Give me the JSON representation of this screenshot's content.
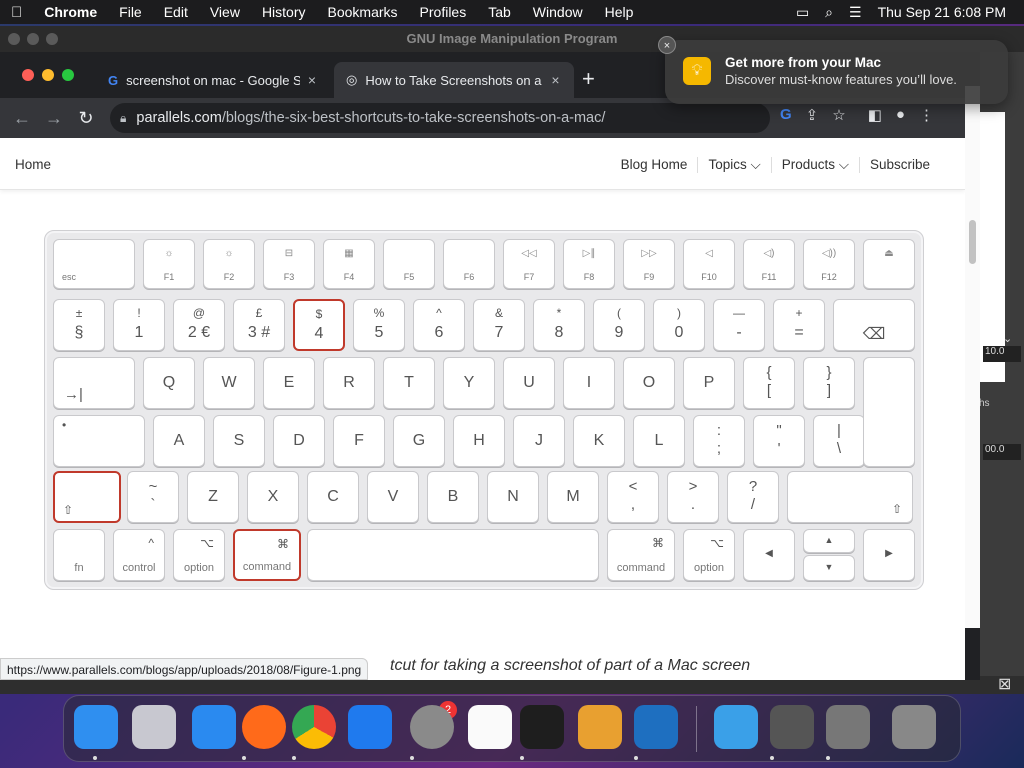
{
  "menubar": {
    "apple_icon": "apple-icon",
    "app": "Chrome",
    "items": [
      "File",
      "Edit",
      "View",
      "History",
      "Bookmarks",
      "Profiles",
      "Tab",
      "Window",
      "Help"
    ],
    "clock": "Thu Sep 21  6:08 PM"
  },
  "gimp": {
    "title": "GNU Image Manipulation Program",
    "zoom1": "10.0",
    "zoom2": "00.0",
    "paths": "hs"
  },
  "browser": {
    "tabs": [
      {
        "title": "screenshot on mac - Google Se",
        "close": "×"
      },
      {
        "title": "How to Take Screenshots on a",
        "close": "×"
      }
    ],
    "new_tab": "+",
    "url_host": "parallels.com",
    "url_path": "/blogs/the-six-best-shortcuts-to-take-screenshots-on-a-mac/"
  },
  "site": {
    "home": "Home",
    "nav": [
      "Blog Home",
      "Topics ⌵",
      "Products ⌵",
      "Subscribe"
    ]
  },
  "keyboard": {
    "fn_row": [
      {
        "s": "esc",
        "g": ""
      },
      {
        "s": "F1",
        "g": "☼"
      },
      {
        "s": "F2",
        "g": "☼"
      },
      {
        "s": "F3",
        "g": "⊟"
      },
      {
        "s": "F4",
        "g": "▦"
      },
      {
        "s": "F5",
        "g": ""
      },
      {
        "s": "F6",
        "g": ""
      },
      {
        "s": "F7",
        "g": "◁◁"
      },
      {
        "s": "F8",
        "g": "▷∥"
      },
      {
        "s": "F9",
        "g": "▷▷"
      },
      {
        "s": "F10",
        "g": "◁"
      },
      {
        "s": "F11",
        "g": "◁)"
      },
      {
        "s": "F12",
        "g": "◁))"
      },
      {
        "s": "",
        "g": "⏏"
      }
    ],
    "num_row": [
      {
        "t": "±",
        "b": "§"
      },
      {
        "t": "!",
        "b": "1"
      },
      {
        "t": "@",
        "b": "2 €"
      },
      {
        "t": "£",
        "b": "3 #"
      },
      {
        "t": "$",
        "b": "4"
      },
      {
        "t": "%",
        "b": "5"
      },
      {
        "t": "^",
        "b": "6"
      },
      {
        "t": "&",
        "b": "7"
      },
      {
        "t": "*",
        "b": "8"
      },
      {
        "t": "(",
        "b": "9"
      },
      {
        "t": ")",
        "b": "0"
      },
      {
        "t": "—",
        "b": "-"
      },
      {
        "t": "+",
        "b": "="
      },
      {
        "t": "",
        "b": "⌫"
      }
    ],
    "q_row": [
      "→|",
      "Q",
      "W",
      "E",
      "R",
      "T",
      "Y",
      "U",
      "I",
      "O",
      "P",
      "{ [",
      "} ]",
      "↵"
    ],
    "a_row": [
      "•",
      "A",
      "S",
      "D",
      "F",
      "G",
      "H",
      "J",
      "K",
      "L",
      ": ;",
      "\" '",
      "| \\"
    ],
    "z_row": [
      "⇧",
      "~ `",
      "Z",
      "X",
      "C",
      "V",
      "B",
      "N",
      "M",
      "< ,",
      "> .",
      "? /",
      "⇧"
    ],
    "bottom_row": [
      {
        "g": "",
        "s": "fn"
      },
      {
        "g": "^",
        "s": "control"
      },
      {
        "g": "⌥",
        "s": "option"
      },
      {
        "g": "⌘",
        "s": "command"
      },
      {
        "g": "",
        "s": ""
      },
      {
        "g": "⌘",
        "s": "command"
      },
      {
        "g": "⌥",
        "s": "option"
      },
      {
        "g": "◀",
        "s": ""
      },
      {
        "g": "▲▼",
        "s": ""
      },
      {
        "g": "▶",
        "s": ""
      }
    ],
    "highlighted": [
      "4",
      "shift",
      "command"
    ]
  },
  "caption": "tcut for taking a screenshot of part of a Mac screen",
  "status_url": "https://www.parallels.com/blogs/app/uploads/2018/08/Figure-1.png",
  "notification": {
    "title": "Get more from your Mac",
    "body": "Discover must-know features you’ll love.",
    "close": "×"
  },
  "dock": {
    "apps": [
      "Finder",
      "Launchpad",
      "Safari",
      "Firefox",
      "Chrome",
      "App Store",
      "System Settings",
      "TextEdit",
      "Terminal",
      "GarageBand",
      "VS Code",
      "Weather",
      "GIMP",
      "Rocket",
      "Trash"
    ],
    "badge": "2"
  }
}
